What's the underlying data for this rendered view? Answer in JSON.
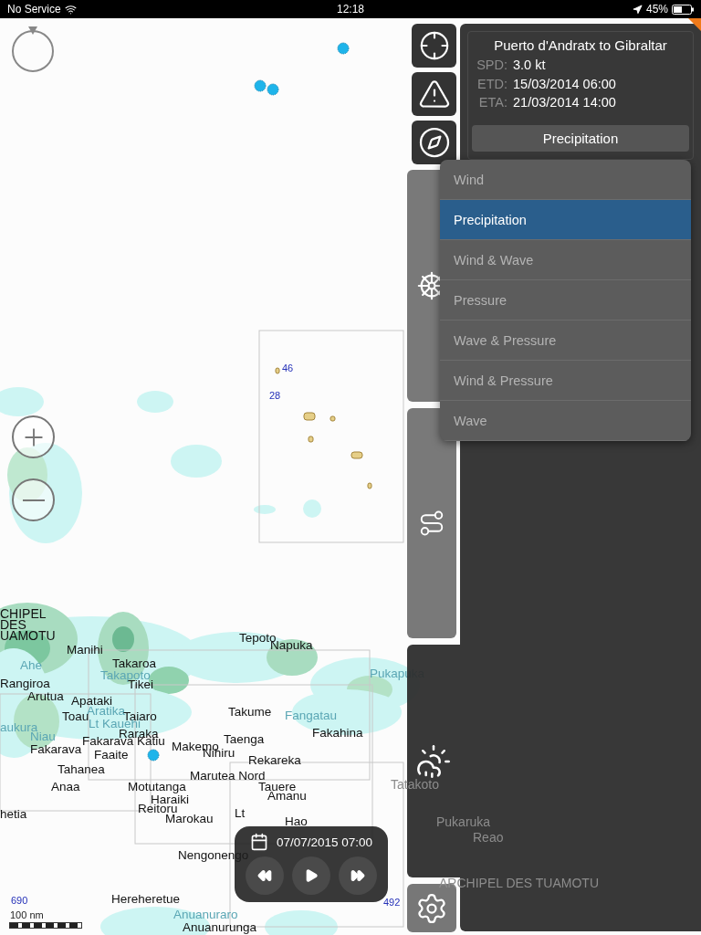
{
  "status_bar": {
    "carrier": "No Service",
    "time": "12:18",
    "battery": "45%"
  },
  "map": {
    "labels": [
      {
        "text": "CHIPEL",
        "kind": "region"
      },
      {
        "text": "DES",
        "kind": "region"
      },
      {
        "text": "UAMOTU",
        "kind": "region"
      },
      {
        "text": "Manihi",
        "kind": "island"
      },
      {
        "text": "Ahe",
        "kind": "reef"
      },
      {
        "text": "Takaroa",
        "kind": "island"
      },
      {
        "text": "Takapoto",
        "kind": "reef"
      },
      {
        "text": "Tikei",
        "kind": "island"
      },
      {
        "text": "Rangiroa",
        "kind": "island"
      },
      {
        "text": "Arutua",
        "kind": "island"
      },
      {
        "text": "Apataki",
        "kind": "island"
      },
      {
        "text": "Aratika",
        "kind": "reef"
      },
      {
        "text": "Toau",
        "kind": "island"
      },
      {
        "text": "Taiaro",
        "kind": "island"
      },
      {
        "text": "Lt Kauehi",
        "kind": "reef"
      },
      {
        "text": "aukura",
        "kind": "reef"
      },
      {
        "text": "Niau",
        "kind": "reef"
      },
      {
        "text": "Raraka",
        "kind": "island"
      },
      {
        "text": "Fakarava",
        "kind": "island"
      },
      {
        "text": "Katiu",
        "kind": "island"
      },
      {
        "text": "Makemo",
        "kind": "island"
      },
      {
        "text": "Taenga",
        "kind": "island"
      },
      {
        "text": "Fakarava",
        "kind": "island"
      },
      {
        "text": "Faaite",
        "kind": "island"
      },
      {
        "text": "Nihiru",
        "kind": "island"
      },
      {
        "text": "Rekareka",
        "kind": "island"
      },
      {
        "text": "Tahanea",
        "kind": "island"
      },
      {
        "text": "Marutea Nord",
        "kind": "island"
      },
      {
        "text": "Anaa",
        "kind": "island"
      },
      {
        "text": "Motutanga",
        "kind": "island"
      },
      {
        "text": "Tauere",
        "kind": "island"
      },
      {
        "text": "Amanu",
        "kind": "island"
      },
      {
        "text": "Haraiki",
        "kind": "island"
      },
      {
        "text": "Reitoru",
        "kind": "island"
      },
      {
        "text": "Lt",
        "kind": "island"
      },
      {
        "text": "Marokau",
        "kind": "island"
      },
      {
        "text": "Hao",
        "kind": "island"
      },
      {
        "text": "hetia",
        "kind": "island"
      },
      {
        "text": "Takume",
        "kind": "island"
      },
      {
        "text": "Fangatau",
        "kind": "reef"
      },
      {
        "text": "Fakahina",
        "kind": "island"
      },
      {
        "text": "Tepoto",
        "kind": "island"
      },
      {
        "text": "Napuka",
        "kind": "island"
      },
      {
        "text": "Pukapuka",
        "kind": "reef"
      },
      {
        "text": "Tatakoto",
        "kind": "shaded"
      },
      {
        "text": "Nengonengo",
        "kind": "island"
      },
      {
        "text": "Hereheretue",
        "kind": "island"
      },
      {
        "text": "Anuanuraro",
        "kind": "reef"
      },
      {
        "text": "Anuanurunga",
        "kind": "island"
      },
      {
        "text": "Pukaruka",
        "kind": "shaded"
      },
      {
        "text": "Reao",
        "kind": "shaded"
      },
      {
        "text": "ARCHIPEL DES TUAMOTU",
        "kind": "shaded"
      }
    ],
    "soundings": [
      "46",
      "28",
      "690",
      "492"
    ],
    "scale": "100 nm"
  },
  "side_tabs": [
    {
      "kind": "helm",
      "selected": false
    },
    {
      "kind": "route",
      "selected": false
    },
    {
      "kind": "weather",
      "selected": true
    }
  ],
  "route": {
    "title": "Puerto d'Andratx to Gibraltar",
    "fields": [
      {
        "label": "SPD:",
        "value": "3.0 kt"
      },
      {
        "label": "ETD:",
        "value": "15/03/2014 06:00"
      },
      {
        "label": "ETA:",
        "value": "21/03/2014 14:00"
      }
    ],
    "layer_button": "Precipitation"
  },
  "layer_menu": [
    {
      "label": "Wind",
      "selected": false
    },
    {
      "label": "Precipitation",
      "selected": true
    },
    {
      "label": "Wind & Wave",
      "selected": false
    },
    {
      "label": "Pressure",
      "selected": false
    },
    {
      "label": "Wave & Pressure",
      "selected": false
    },
    {
      "label": "Wind & Pressure",
      "selected": false
    },
    {
      "label": "Wave",
      "selected": false
    }
  ],
  "timeline": {
    "date": "07/07/2015 07:00"
  }
}
